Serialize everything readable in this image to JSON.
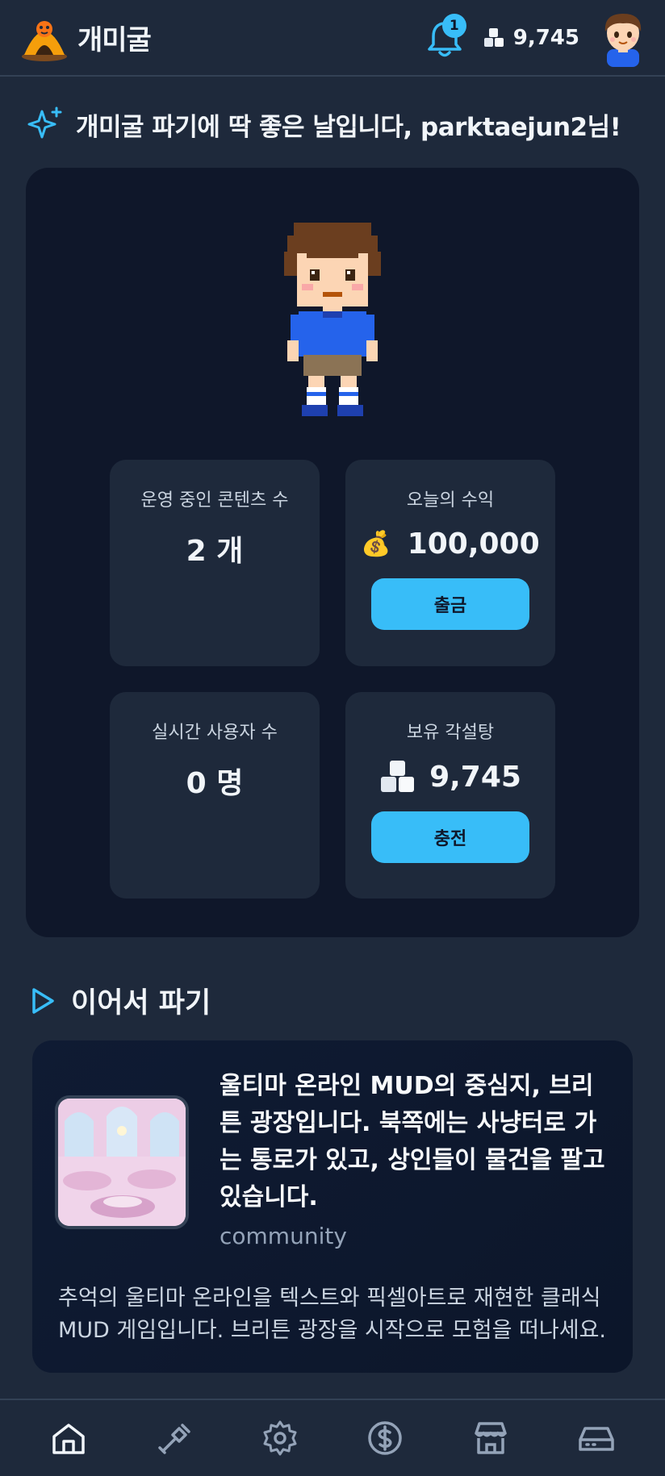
{
  "header": {
    "app_title": "개미굴",
    "notification_count": "1",
    "sugar_count": "9,745"
  },
  "greeting": "개미굴 파기에 딱 좋은 날입니다, parktaejun2님!",
  "stats": {
    "contents": {
      "label": "운영 중인 콘텐츠 수",
      "value": "2 개"
    },
    "earnings": {
      "label": "오늘의 수익",
      "icon": "💰",
      "value": "100,000",
      "button": "출금"
    },
    "users": {
      "label": "실시간 사용자 수",
      "value": "0 명"
    },
    "sugar": {
      "label": "보유 각설탕",
      "value": "9,745",
      "button": "충전"
    }
  },
  "continue": {
    "title": "이어서 파기",
    "card": {
      "title": "울티마 온라인 MUD의 중심지, 브리튼 광장입니다. 북쪽에는 사냥터로 가는 통로가 있고, 상인들이 물건을 팔고 있습니다.",
      "category": "community",
      "description": "추억의 울티마 온라인을 텍스트와 픽셀아트로 재현한 클래식 MUD 게임입니다. 브리튼 광장을 시작으로 모험을 떠나세요."
    }
  },
  "nav": [
    "home-icon",
    "shovel-icon",
    "gear-icon",
    "dollar-icon",
    "store-icon",
    "drive-icon"
  ],
  "colors": {
    "accent": "#38bdf8",
    "background": "#1e293b",
    "card": "#0f172a"
  }
}
